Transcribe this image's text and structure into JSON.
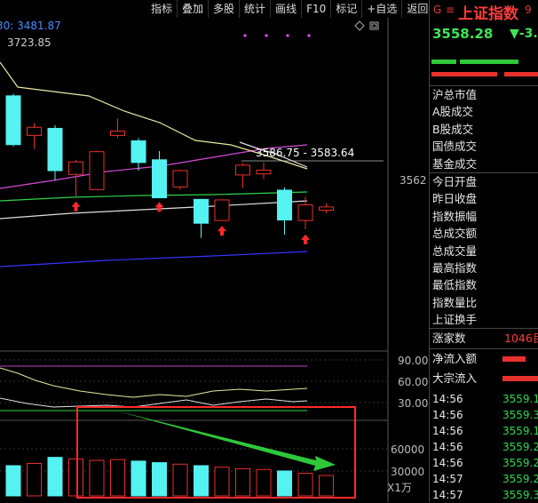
{
  "toolbar": {
    "buttons": [
      "指标",
      "叠加",
      "多股",
      "统计",
      "画线",
      "F10",
      "标记",
      "+自选",
      "返回"
    ]
  },
  "chart": {
    "ma_label_partial": "30: 3481.87",
    "high_label": "3723.85",
    "price_tag": "3562",
    "range_label": "3586.75 - 3583.64",
    "indicator_axis": [
      "90.00",
      "60.00",
      "30.00"
    ],
    "volume_axis": [
      "60000",
      "30000"
    ],
    "volume_unit": "X1万",
    "candles": [
      {
        "o": 3718,
        "h": 3722,
        "l": 3625,
        "c": 3628
      },
      {
        "o": 3645,
        "h": 3668,
        "l": 3620,
        "c": 3660
      },
      {
        "o": 3658,
        "h": 3664,
        "l": 3562,
        "c": 3580
      },
      {
        "o": 3573,
        "h": 3600,
        "l": 3533,
        "c": 3596
      },
      {
        "o": 3545,
        "h": 3617,
        "l": 3545,
        "c": 3615
      },
      {
        "o": 3645,
        "h": 3676,
        "l": 3640,
        "c": 3653
      },
      {
        "o": 3635,
        "h": 3640,
        "l": 3580,
        "c": 3595
      },
      {
        "o": 3600,
        "h": 3616,
        "l": 3532,
        "c": 3530
      },
      {
        "o": 3550,
        "h": 3582,
        "l": 3545,
        "c": 3580
      },
      {
        "o": 3527,
        "h": 3528,
        "l": 3456,
        "c": 3483
      },
      {
        "o": 3488,
        "h": 3527,
        "l": 3488,
        "c": 3526
      },
      {
        "o": 3572,
        "h": 3594,
        "l": 3548,
        "c": 3590
      },
      {
        "o": 3574,
        "h": 3595,
        "l": 3564,
        "c": 3581
      },
      {
        "o": 3544,
        "h": 3549,
        "l": 3462,
        "c": 3489
      },
      {
        "o": 3488,
        "h": 3532,
        "l": 3472,
        "c": 3517
      },
      {
        "o": 3507,
        "h": 3520,
        "l": 3502,
        "c": 3513
      }
    ],
    "up_markers": [
      3,
      7,
      10,
      14
    ],
    "volumes": [
      40000,
      43000,
      51000,
      49000,
      47000,
      48000,
      46000,
      44000,
      42000,
      40000,
      38000,
      36000,
      35000,
      33000,
      30000,
      27000
    ],
    "colors": {
      "up": "#e8302c",
      "down": "#55f2f2",
      "ma5": "#e8e8a0",
      "ma10": "#d84ad8",
      "ma20": "#2fd24a",
      "ma60": "#e0e0e0",
      "ma120": "#3434ff",
      "annotation": "#ff2a2a",
      "arrow": "#2ec83a"
    }
  },
  "panel": {
    "g_label": "G",
    "menu_icon": "≡",
    "title": "上证指数",
    "title_extra": "9",
    "price": "3558.28",
    "change": "▼-3.",
    "labels": [
      "沪总市值",
      "A股成交",
      "B股成交",
      "国债成交",
      "基金成交",
      "今日开盘",
      "昨日收盘",
      "指数振幅",
      "总成交额",
      "总成交量",
      "最高指数",
      "最低指数",
      "指数量比",
      "上证换手"
    ],
    "up_count_label": "涨家数",
    "up_count": "1046",
    "up_count_tail": "目",
    "net_inflow": "净流入额",
    "block_inflow": "大宗流入",
    "ticks": [
      {
        "time": "14:56",
        "price": "3559.1"
      },
      {
        "time": "14:56",
        "price": "3559.3"
      },
      {
        "time": "14:56",
        "price": "3559.1"
      },
      {
        "time": "14:56",
        "price": "3559.2"
      },
      {
        "time": "14:56",
        "price": "3559.2"
      },
      {
        "time": "14:57",
        "price": "3559.2"
      },
      {
        "time": "14:57",
        "price": "3559.3"
      }
    ]
  }
}
